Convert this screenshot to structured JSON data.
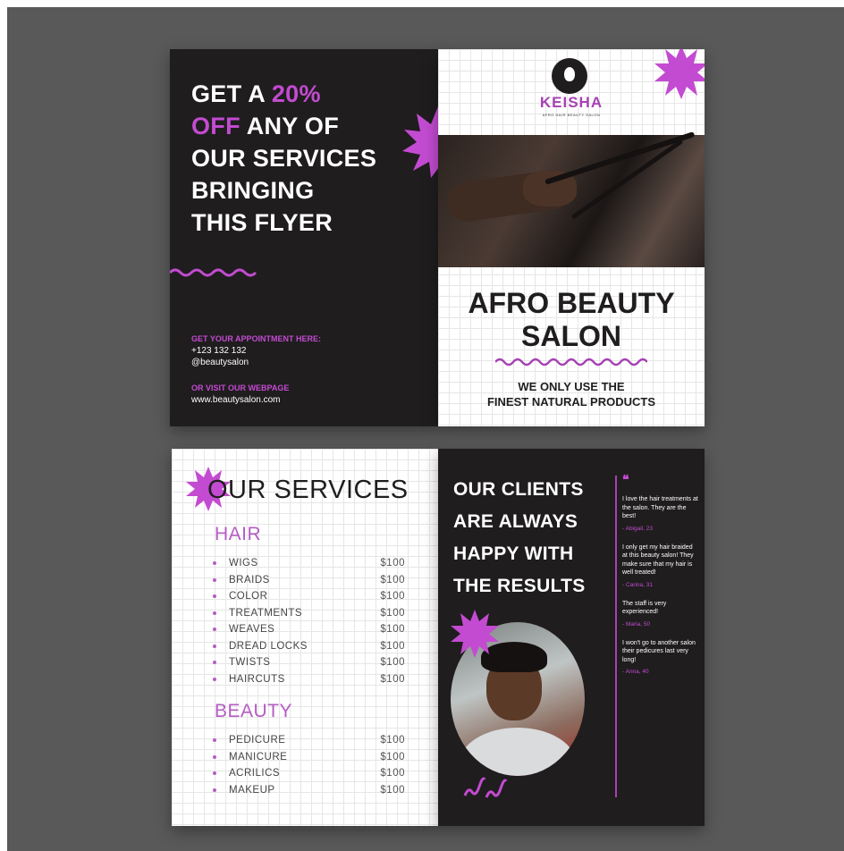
{
  "colors": {
    "background": "#595959",
    "dark_panel": "#1f1d1e",
    "accent_pink": "#c34bd1",
    "accent_purple": "#a642b3",
    "text_white": "#ffffff"
  },
  "flyer_front": {
    "headline": {
      "lines": [
        {
          "pre": "GET A ",
          "highlight": "20%",
          "post": ""
        },
        {
          "pre": "",
          "highlight": "OFF",
          "post": " ANY OF"
        },
        {
          "pre": "OUR SERVICES",
          "highlight": "",
          "post": ""
        },
        {
          "pre": "BRINGING",
          "highlight": "",
          "post": ""
        },
        {
          "pre": "THIS FLYER",
          "highlight": "",
          "post": ""
        }
      ]
    },
    "appointment_label": "GET YOUR APPOINTMENT HERE:",
    "phone": "+123 132 132",
    "handle": "@beautysalon",
    "webpage_label": "OR VISIT OUR WEBPAGE",
    "website": "www.beautysalon.com",
    "brand_name": "KEISHA",
    "brand_subtitle": "AFRO HAIR BEAUTY SALON",
    "logo_icon": "woman-silhouette-icon",
    "salon_title": [
      "AFRO BEAUTY",
      "SALON"
    ],
    "tagline": [
      "WE ONLY USE THE",
      "FINEST NATURAL PRODUCTS"
    ]
  },
  "flyer_back": {
    "services_title": "OUR SERVICES",
    "categories": [
      {
        "name": "HAIR",
        "items": [
          {
            "name": "WIGS",
            "price": "$100"
          },
          {
            "name": "BRAIDS",
            "price": "$100"
          },
          {
            "name": "COLOR",
            "price": "$100"
          },
          {
            "name": "TREATMENTS",
            "price": "$100"
          },
          {
            "name": "WEAVES",
            "price": "$100"
          },
          {
            "name": "DREAD LOCKS",
            "price": "$100"
          },
          {
            "name": "TWISTS",
            "price": "$100"
          },
          {
            "name": "HAIRCUTS",
            "price": "$100"
          }
        ]
      },
      {
        "name": "BEAUTY",
        "items": [
          {
            "name": "PEDICURE",
            "price": "$100"
          },
          {
            "name": "MANICURE",
            "price": "$100"
          },
          {
            "name": "ACRILICS",
            "price": "$100"
          },
          {
            "name": "MAKEUP",
            "price": "$100"
          }
        ]
      }
    ],
    "clients_heading": [
      "OUR CLIENTS",
      "ARE ALWAYS",
      "HAPPY WITH",
      "THE RESULTS"
    ],
    "quote_mark": "❝",
    "reviews": [
      {
        "text": "I love the hair treatments at the salon. They are the best!",
        "author": "- Abigail, 23"
      },
      {
        "text": "I only get my hair braided at this beauty salon! They make sure that my hair is well treated!",
        "author": "- Carina, 31"
      },
      {
        "text": "The staff is very experienced!",
        "author": "- Maria, 50"
      },
      {
        "text": "I won't go to another salon their pedicures last very long!",
        "author": "- Anna, 40"
      }
    ]
  }
}
